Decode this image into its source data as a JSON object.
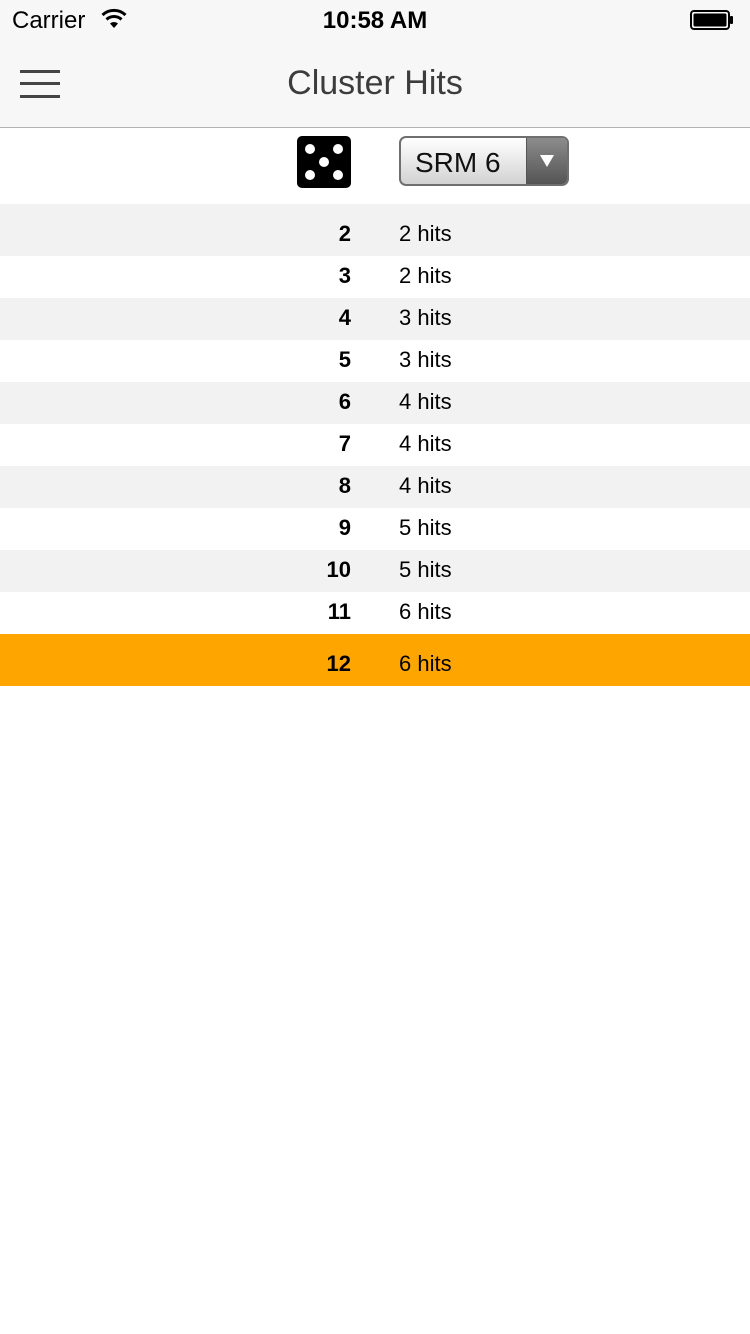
{
  "status_bar": {
    "carrier": "Carrier",
    "time": "10:58 AM"
  },
  "nav": {
    "title": "Cluster Hits",
    "menu_icon": "hamburger-menu-icon"
  },
  "controls": {
    "die_icon": "die-five-icon",
    "dropdown": {
      "selected": "SRM 6",
      "arrow_icon": "chevron-down-icon"
    }
  },
  "colors": {
    "highlight": "#ffa500",
    "stripe": "#f2f2f2"
  },
  "rows": [
    {
      "roll": "2",
      "hits": "2 hits"
    },
    {
      "roll": "3",
      "hits": "2 hits"
    },
    {
      "roll": "4",
      "hits": "3 hits"
    },
    {
      "roll": "5",
      "hits": "3 hits"
    },
    {
      "roll": "6",
      "hits": "4 hits"
    },
    {
      "roll": "7",
      "hits": "4 hits"
    },
    {
      "roll": "8",
      "hits": "4 hits"
    },
    {
      "roll": "9",
      "hits": "5 hits"
    },
    {
      "roll": "10",
      "hits": "5 hits"
    },
    {
      "roll": "11",
      "hits": "6 hits"
    },
    {
      "roll": "12",
      "hits": "6 hits",
      "highlighted": true
    }
  ]
}
